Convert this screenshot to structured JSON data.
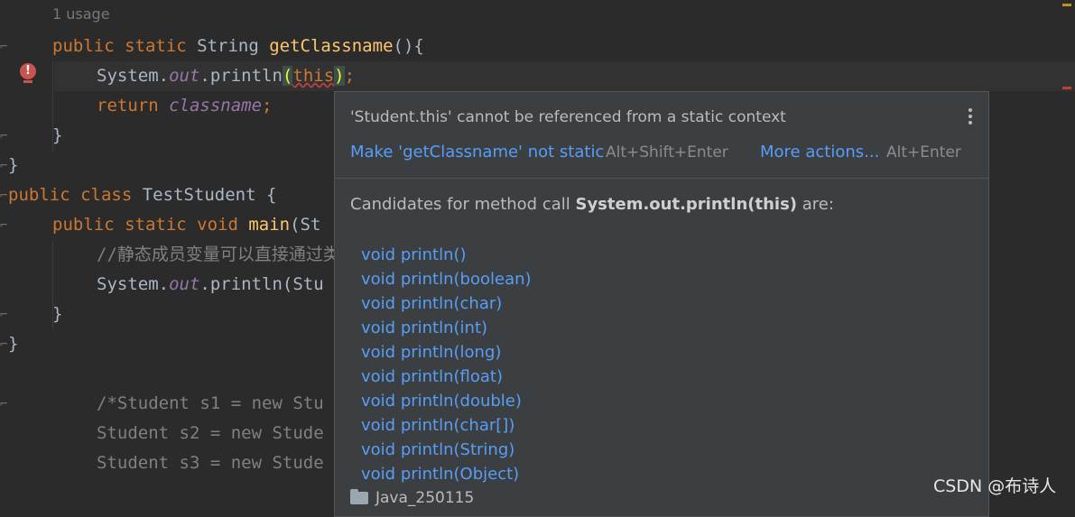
{
  "editor": {
    "usage_hint": "1 usage",
    "lines": {
      "l1": {
        "kw": "public static",
        "type": " String ",
        "fn": "getClassname",
        "rest": "(){"
      },
      "l2": {
        "a": "System.",
        "b": "out",
        "c": ".println",
        "d": "(",
        "e": "this",
        "f": ")",
        "g": ";"
      },
      "l3": {
        "kw": "return ",
        "stat": "classname",
        "rest": ";"
      },
      "l4": "}",
      "l5": "}",
      "l6": {
        "kw": "public class",
        "rest": " TestStudent {"
      },
      "l7": {
        "kw": "public static void",
        "fn": " main",
        "rest": "(St"
      },
      "l8": "//静态成员变量可以直接通过类",
      "l9": {
        "a": "System.",
        "b": "out",
        "c": ".println(Stu"
      },
      "l10": "}",
      "l11": "}",
      "l12": "/*Student s1 = new Stu",
      "l13": "Student s2 = new Stude",
      "l14": "Student s3 = new Stude"
    }
  },
  "popup": {
    "problem": "'Student.this' cannot be referenced from a static context",
    "fix_label": "Make 'getClassname' not static",
    "fix_shortcut": "Alt+Shift+Enter",
    "more_label": "More actions...",
    "more_shortcut": "Alt+Enter",
    "candidates_prefix": "Candidates for method call ",
    "candidates_call": "System.out.println(this)",
    "candidates_suffix": " are:",
    "candidates": [
      "void println()",
      "void println(boolean)",
      "void println(char)",
      "void println(int)",
      "void println(long)",
      "void println(float)",
      "void println(double)",
      "void println(char[])",
      "void println(String)",
      "void println(Object)"
    ],
    "module": "Java_250115"
  },
  "watermark": "CSDN @布诗人",
  "colors": {
    "editor_bg": "#2b2b2b",
    "popup_bg": "#3c3f41",
    "link": "#589df6",
    "keyword": "#cc7832",
    "error": "#c75450"
  }
}
